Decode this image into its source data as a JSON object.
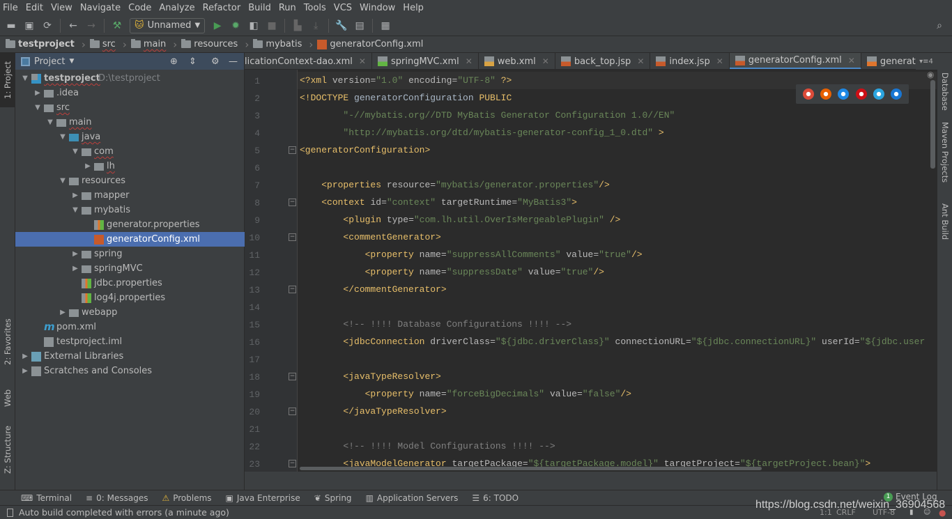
{
  "menu": [
    "File",
    "Edit",
    "View",
    "Navigate",
    "Code",
    "Analyze",
    "Refactor",
    "Build",
    "Run",
    "Tools",
    "VCS",
    "Window",
    "Help"
  ],
  "toolbar": {
    "run_config": "Unnamed",
    "icons": [
      "open-icon",
      "save-icon",
      "sync-icon",
      "back-icon",
      "forward-icon",
      "build-icon",
      "run-icon",
      "debug-icon",
      "coverage-icon",
      "stop-icon",
      "deploy-icon",
      "download-icon",
      "settings-wrench-icon",
      "project-structure-icon",
      "sdk-icon"
    ]
  },
  "breadcrumb": [
    "testproject",
    "src",
    "main",
    "resources",
    "mybatis",
    "generatorConfig.xml"
  ],
  "left_strip": {
    "project": "1: Project",
    "favorites": "2: Favorites",
    "web": "Web",
    "structure": "Z: Structure"
  },
  "right_strip": {
    "database": "Database",
    "maven": "Maven Projects",
    "ant": "Ant Build"
  },
  "project_panel": {
    "title": "Project",
    "tree": [
      {
        "label": "testproject",
        "level": 0,
        "kind": "module",
        "state": "open",
        "bold": true,
        "path": "D:\\testproject",
        "squiggle": true
      },
      {
        "label": ".idea",
        "level": 1,
        "kind": "folder",
        "state": "closed"
      },
      {
        "label": "src",
        "level": 1,
        "kind": "folder",
        "state": "open",
        "squiggle": true
      },
      {
        "label": "main",
        "level": 2,
        "kind": "folder",
        "state": "open",
        "squiggle": true
      },
      {
        "label": "java",
        "level": 3,
        "kind": "src-folder",
        "state": "open",
        "squiggle": true
      },
      {
        "label": "com",
        "level": 4,
        "kind": "package",
        "state": "open",
        "squiggle": true
      },
      {
        "label": "lh",
        "level": 5,
        "kind": "package",
        "state": "closed",
        "squiggle": true
      },
      {
        "label": "resources",
        "level": 3,
        "kind": "res-folder",
        "state": "open"
      },
      {
        "label": "mapper",
        "level": 4,
        "kind": "package",
        "state": "closed"
      },
      {
        "label": "mybatis",
        "level": 4,
        "kind": "package",
        "state": "open"
      },
      {
        "label": "generator.properties",
        "level": 5,
        "kind": "properties"
      },
      {
        "label": "generatorConfig.xml",
        "level": 5,
        "kind": "xml",
        "selected": true
      },
      {
        "label": "spring",
        "level": 4,
        "kind": "package",
        "state": "closed"
      },
      {
        "label": "springMVC",
        "level": 4,
        "kind": "package",
        "state": "closed"
      },
      {
        "label": "jdbc.properties",
        "level": 4,
        "kind": "properties"
      },
      {
        "label": "log4j.properties",
        "level": 4,
        "kind": "properties"
      },
      {
        "label": "webapp",
        "level": 3,
        "kind": "web-folder",
        "state": "closed"
      },
      {
        "label": "pom.xml",
        "level": 1,
        "kind": "maven"
      },
      {
        "label": "testproject.iml",
        "level": 1,
        "kind": "iml"
      },
      {
        "label": "External Libraries",
        "level": 0,
        "kind": "libraries",
        "state": "closed"
      },
      {
        "label": "Scratches and Consoles",
        "level": 0,
        "kind": "scratches",
        "state": "closed"
      }
    ]
  },
  "tabs": [
    {
      "label": "licationContext-dao.xml",
      "kind": "xml"
    },
    {
      "label": "springMVC.xml",
      "kind": "spring-xml"
    },
    {
      "label": "web.xml",
      "kind": "web-xml"
    },
    {
      "label": "back_top.jsp",
      "kind": "jsp"
    },
    {
      "label": "index.jsp",
      "kind": "jsp"
    },
    {
      "label": "generatorConfig.xml",
      "kind": "xml",
      "active": true
    },
    {
      "label": "generator.properties",
      "kind": "properties"
    }
  ],
  "tab_overflow": "4",
  "editor": {
    "current_line": 1,
    "fold_lines": [
      5,
      8,
      10,
      13,
      18,
      20,
      23
    ],
    "lines": [
      "<?xml version=\"1.0\" encoding=\"UTF-8\" ?>",
      "<!DOCTYPE generatorConfiguration PUBLIC",
      "        \"-//mybatis.org//DTD MyBatis Generator Configuration 1.0//EN\"",
      "        \"http://mybatis.org/dtd/mybatis-generator-config_1_0.dtd\" >",
      "<generatorConfiguration>",
      "",
      "    <properties resource=\"mybatis/generator.properties\"/>",
      "    <context id=\"context\" targetRuntime=\"MyBatis3\">",
      "        <plugin type=\"com.lh.util.OverIsMergeablePlugin\" />",
      "        <commentGenerator>",
      "            <property name=\"suppressAllComments\" value=\"true\"/>",
      "            <property name=\"suppressDate\" value=\"true\"/>",
      "        </commentGenerator>",
      "",
      "        <!-- !!!! Database Configurations !!!! -->",
      "        <jdbcConnection driverClass=\"${jdbc.driverClass}\" connectionURL=\"${jdbc.connectionURL}\" userId=\"${jdbc.user",
      "",
      "        <javaTypeResolver>",
      "            <property name=\"forceBigDecimals\" value=\"false\"/>",
      "        </javaTypeResolver>",
      "",
      "        <!-- !!!! Model Configurations !!!! -->",
      "        <javaModelGenerator targetPackage=\"${targetPackage.model}\" targetProject=\"${targetProject.bean}\">"
    ]
  },
  "browsers": [
    {
      "name": "chrome-icon",
      "color": "#dd4b39"
    },
    {
      "name": "firefox-icon",
      "color": "#e66000"
    },
    {
      "name": "safari-icon",
      "color": "#1e88e5"
    },
    {
      "name": "opera-icon",
      "color": "#cc0f16"
    },
    {
      "name": "ie-icon",
      "color": "#2ba5e0"
    },
    {
      "name": "edge-icon",
      "color": "#1976d2"
    }
  ],
  "tool_windows": [
    {
      "label": "Terminal",
      "icon": "terminal-icon"
    },
    {
      "label": "0: Messages",
      "icon": "messages-icon"
    },
    {
      "label": "Problems",
      "icon": "warning-icon"
    },
    {
      "label": "Java Enterprise",
      "icon": "java-enterprise-icon"
    },
    {
      "label": "Spring",
      "icon": "spring-icon"
    },
    {
      "label": "Application Servers",
      "icon": "servers-icon"
    },
    {
      "label": "6: TODO",
      "icon": "todo-icon"
    }
  ],
  "event_log": {
    "label": "Event Log",
    "count": "1"
  },
  "status": {
    "message": "Auto build completed with errors (a minute ago)",
    "position": "1:1",
    "line_sep": "CRLF",
    "encoding": "UTF-8"
  },
  "watermark": "https://blog.csdn.net/weixin_36904568",
  "colors": {
    "tag": "#e8bf6a",
    "attr": "#bababa",
    "string": "#6a8759",
    "comment": "#808080",
    "selection": "#4b6eaf",
    "accent": "#4a88c7"
  }
}
